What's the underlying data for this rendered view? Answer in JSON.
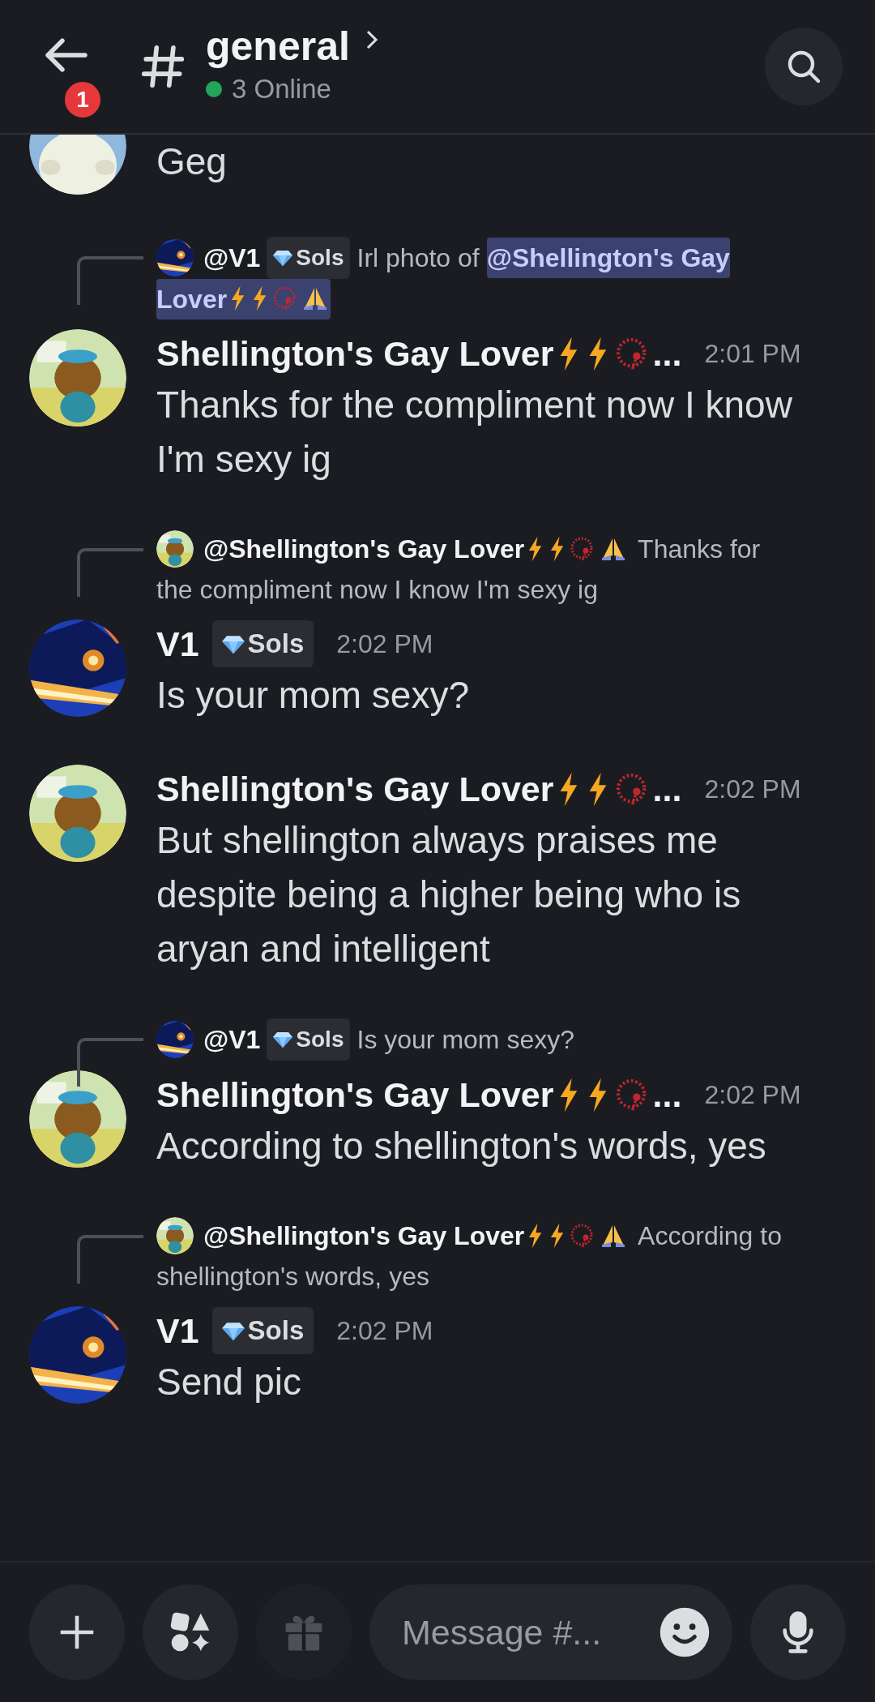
{
  "header": {
    "back_badge": "1",
    "channel": "general",
    "online": "3 Online"
  },
  "messages": [
    {
      "avatar": {
        "kind": "ghost"
      },
      "text": "Geg"
    },
    {
      "reply": {
        "avatar": {
          "kind": "robot"
        },
        "author": "@V1",
        "badge": "Sols",
        "segments": [
          {
            "kind": "text",
            "text": "Irl photo of "
          },
          {
            "kind": "mention",
            "text": "@Shellington's Gay"
          }
        ],
        "second_line": [
          {
            "kind": "mention",
            "text": "Lover",
            "emojis": [
              {
                "kind": "bolt"
              },
              {
                "kind": "bolt"
              },
              {
                "kind": "beads"
              },
              {
                "kind": "hands"
              }
            ]
          }
        ]
      },
      "avatar": {
        "kind": "bear"
      },
      "author": {
        "name": "Shellington's Gay Lover",
        "emojis": [
          {
            "kind": "bolt"
          },
          {
            "kind": "bolt"
          },
          {
            "kind": "beads"
          }
        ],
        "ellipsis": "..."
      },
      "time": "2:01 PM",
      "text": "Thanks for the compliment now I know I'm sexy ig"
    },
    {
      "reply": {
        "avatar": {
          "kind": "bear"
        },
        "author": "@Shellington's Gay Lover",
        "emojis": [
          {
            "kind": "bolt"
          },
          {
            "kind": "bolt"
          },
          {
            "kind": "beads"
          },
          {
            "kind": "hands"
          }
        ],
        "segments": [
          {
            "kind": "text",
            "text": "Thanks for"
          }
        ],
        "second_line": [
          {
            "kind": "text",
            "text": "the compliment now I know I'm sexy ig"
          }
        ]
      },
      "avatar": {
        "kind": "robot"
      },
      "author": {
        "name": "V1",
        "badge": "Sols"
      },
      "time": "2:02 PM",
      "text": "Is your mom sexy?"
    },
    {
      "avatar": {
        "kind": "bear"
      },
      "author": {
        "name": "Shellington's Gay Lover",
        "emojis": [
          {
            "kind": "bolt"
          },
          {
            "kind": "bolt"
          },
          {
            "kind": "beads"
          }
        ],
        "ellipsis": "..."
      },
      "time": "2:02 PM",
      "text": "But shellington always praises me despite being a higher being who is aryan and intelligent"
    },
    {
      "reply": {
        "avatar": {
          "kind": "robot"
        },
        "author": "@V1",
        "badge": "Sols",
        "segments": [
          {
            "kind": "text",
            "text": "Is your mom sexy?"
          }
        ]
      },
      "avatar": {
        "kind": "bear"
      },
      "author": {
        "name": "Shellington's Gay Lover",
        "emojis": [
          {
            "kind": "bolt"
          },
          {
            "kind": "bolt"
          },
          {
            "kind": "beads"
          }
        ],
        "ellipsis": "..."
      },
      "time": "2:02 PM",
      "text": "According to shellington's words, yes"
    },
    {
      "reply": {
        "avatar": {
          "kind": "bear"
        },
        "author": "@Shellington's Gay Lover",
        "emojis": [
          {
            "kind": "bolt"
          },
          {
            "kind": "bolt"
          },
          {
            "kind": "beads"
          },
          {
            "kind": "hands"
          }
        ],
        "segments": [
          {
            "kind": "text",
            "text": "According to"
          }
        ],
        "second_line": [
          {
            "kind": "text",
            "text": "shellington's words, yes"
          }
        ]
      },
      "avatar": {
        "kind": "robot"
      },
      "author": {
        "name": "V1",
        "badge": "Sols"
      },
      "time": "2:02 PM",
      "text": "Send pic"
    }
  ],
  "composer": {
    "placeholder": "Message #...",
    "gift_disabled": true
  }
}
